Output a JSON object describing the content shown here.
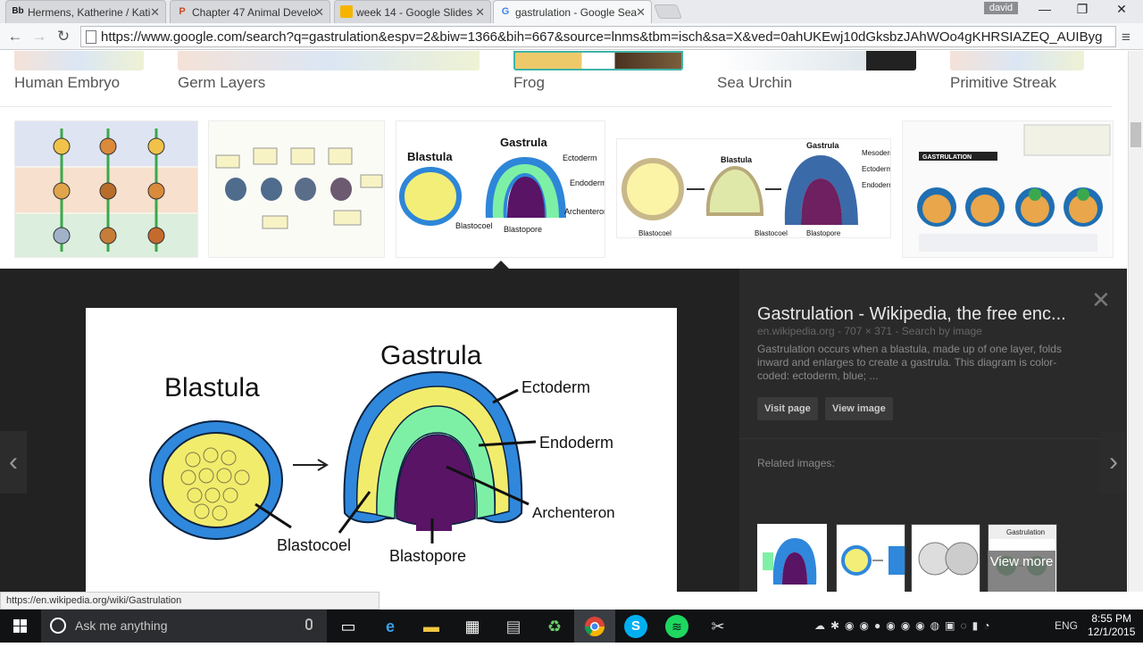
{
  "tabs": [
    {
      "icon": "Bb",
      "title": "Hermens, Katherine / Kati",
      "icon_color": "#1a1a1a",
      "icon_bg": "transparent"
    },
    {
      "icon": "P",
      "title": "Chapter 47 Animal Develo",
      "icon_color": "#d04a25",
      "icon_bg": "transparent"
    },
    {
      "icon": "",
      "title": "week 14 - Google Slides",
      "icon_color": "#f4b400",
      "icon_bg": "#f4b400"
    },
    {
      "icon": "G",
      "title": "gastrulation - Google Sea",
      "icon_color": "#4285f4",
      "icon_bg": "transparent"
    }
  ],
  "tab_close": "✕",
  "user_badge": "david",
  "window": {
    "minimize": "—",
    "maximize": "❐",
    "close": "✕"
  },
  "nav": {
    "back": "←",
    "forward": "→",
    "reload": "↻",
    "menu": "≡"
  },
  "address": "https://www.google.com/search?q=gastrulation&espv=2&biw=1366&bih=667&source=lnms&tbm=isch&sa=X&ved=0ahUKEwj10dGksbzJAhWOo4gKHRSIAZEQ_AUIByg",
  "categories": [
    "Human Embryo",
    "Germ Layers",
    "Frog",
    "Sea Urchin",
    "Primitive Streak"
  ],
  "thumb_labels": {
    "blastula": "Blastula",
    "gastrula": "Gastrula",
    "ectoderm": "Ectoderm",
    "endoderm": "Endoderm",
    "archenteron": "Archenteron",
    "blastocoel": "Blastocoel",
    "blastopore": "Blastopore",
    "mesoderm": "Mesoderm",
    "gastrulation": "GASTRULATION"
  },
  "preview": {
    "title": "Gastrulation - Wikipedia, the free enc...",
    "meta": "en.wikipedia.org - 707 × 371 - Search by image",
    "description": "Gastrulation occurs when a blastula, made up of one layer, folds inward and enlarges to create a gastrula. This diagram is color-coded: ectoderm, blue; ...",
    "visit_page": "Visit page",
    "view_image": "View image",
    "close": "✕",
    "prev": "‹",
    "next": "›",
    "related_label": "Related images:",
    "view_more": "View more",
    "related_caption": "Gastrulation"
  },
  "diagram": {
    "blastula": "Blastula",
    "gastrula": "Gastrula",
    "ectoderm": "Ectoderm",
    "endoderm": "Endoderm",
    "archenteron": "Archenteron",
    "blastocoel": "Blastocoel",
    "blastopore": "Blastopore"
  },
  "status_url": "https://en.wikipedia.org/wiki/Gastrulation",
  "taskbar": {
    "search_placeholder": "Ask me anything",
    "language": "ENG",
    "time": "8:55 PM",
    "date": "12/1/2015"
  },
  "colors": {
    "ectoderm": "#3b8fd9",
    "endoderm": "#7ef0a6",
    "archenteron": "#5a1466",
    "blastocoel": "#f3ee78"
  }
}
